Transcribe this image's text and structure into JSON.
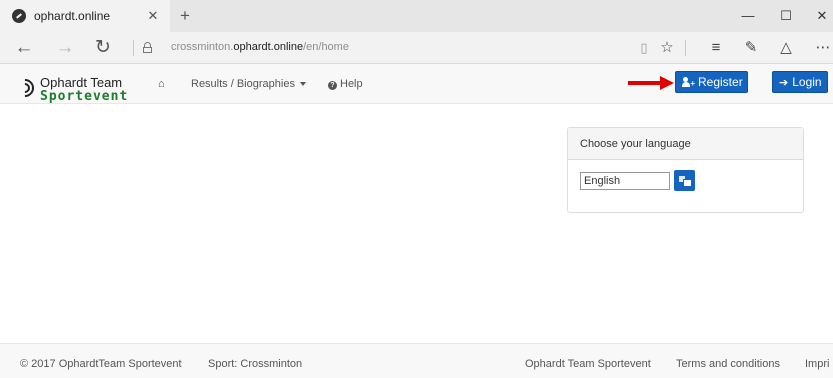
{
  "browser": {
    "tab_title": "ophardt.online",
    "tab_close": "✕",
    "new_tab": "+",
    "window_controls": {
      "minimize": "—",
      "maximize": "☐",
      "close": "✕"
    },
    "url_prefix": "crossminton.",
    "url_domain": "ophardt.online",
    "url_path": "/en/home",
    "icons": [
      "back-icon",
      "forward-icon",
      "refresh-icon",
      "lock-icon",
      "reading-view-icon",
      "favorite-star-icon",
      "hub-icon",
      "web-note-icon",
      "share-icon",
      "more-icon"
    ]
  },
  "site": {
    "logo_top": "Ophardt Team",
    "logo_bottom": "Sportevent",
    "nav": {
      "results_label": "Results / Biographies",
      "help_label": "Help"
    },
    "register_label": "Register",
    "login_label": "Login",
    "accent_color": "#1565c0",
    "annotation_arrow_color": "#e00000"
  },
  "language_panel": {
    "heading": "Choose your language",
    "input_value": "English"
  },
  "footer": {
    "copyright": "© 2017 OphardtTeam Sportevent",
    "sport": "Sport: Crossminton",
    "link_1": "Ophardt Team Sportevent",
    "link_2": "Terms and conditions",
    "link_3": "Impri"
  }
}
